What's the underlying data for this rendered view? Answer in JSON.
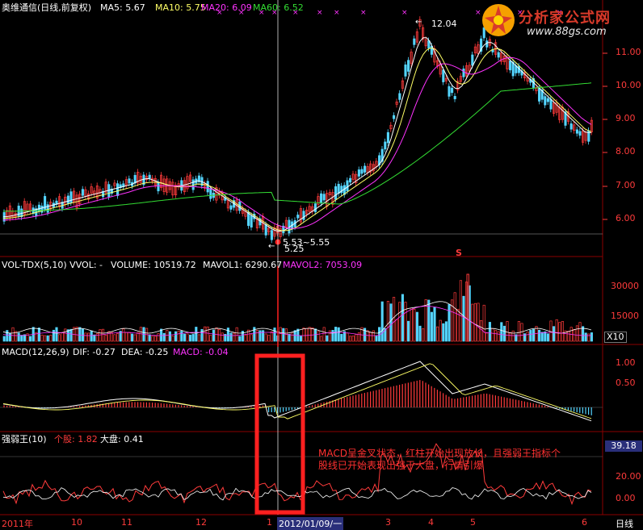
{
  "price_panel": {
    "stock_name": "奥维通信(日线,前复权)",
    "ma5": "MA5: 5.67",
    "ma10": "MA10: 5.75",
    "ma20": "MA20: 6.09",
    "ma60": "MA60: 6.52",
    "high_label": "12.04",
    "low_label": "5.25",
    "mid_label": "5.53~5.55",
    "marker": "S",
    "y_ticks": [
      "11.00",
      "10.00",
      "9.00",
      "8.00",
      "7.00",
      "6.00"
    ]
  },
  "volume_panel": {
    "title": "VOL-TDX(5,10) VVOL: -",
    "volume": "VOLUME: 10519.72",
    "mavol1": "MAVOL1: 6290.67",
    "mavol2": "MAVOL2: 7053.09",
    "y_ticks": [
      "30000",
      "15000"
    ],
    "unit": "X10"
  },
  "macd_panel": {
    "title": "MACD(12,26,9)",
    "dif": "DIF: -0.27",
    "dea": "DEA: -0.25",
    "macd": "MACD: -0.04",
    "y_ticks": [
      "1.00",
      "0.50"
    ]
  },
  "strength_panel": {
    "title": "强弱王(10)",
    "stock": "个股: 1.82",
    "index": "大盘: 0.41",
    "current_value": "39.18",
    "y_ticks": [
      "20.00",
      "0.00"
    ],
    "annotation": "MACD呈金叉状态，红柱开始出现放长，且强弱王指标个股线已开始表现出强于大盘，行情引爆"
  },
  "x_axis": {
    "labels": [
      "2011年",
      "10",
      "11",
      "12",
      "1",
      "2012/01/09/一",
      "3",
      "4",
      "5",
      "6",
      "日线"
    ]
  },
  "watermark": {
    "site_name": "分析家公式网",
    "url": "www.88gs.com"
  },
  "colors": {
    "up": "#ff3b3b",
    "down": "#55d5ff",
    "ma5": "#ffffff",
    "ma10": "#ffff66",
    "ma20": "#ff33ff",
    "ma60": "#33dd33",
    "grid": "#8b0000",
    "highlight": "#ff2020"
  }
}
